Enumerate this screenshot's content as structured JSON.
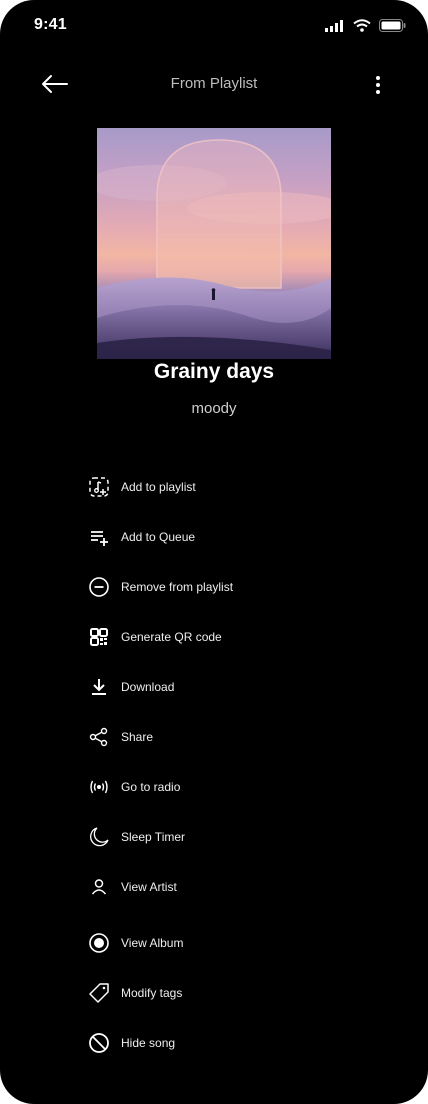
{
  "status_bar": {
    "time": "9:41"
  },
  "header": {
    "title": "From Playlist"
  },
  "track": {
    "title": "Grainy days",
    "subtitle": "moody"
  },
  "menu": [
    {
      "label": "Add to playlist",
      "icon": "add-to-playlist-icon"
    },
    {
      "label": "Add to Queue",
      "icon": "add-to-queue-icon"
    },
    {
      "label": "Remove from playlist",
      "icon": "remove-circle-icon"
    },
    {
      "label": "Generate QR code",
      "icon": "qr-code-icon"
    },
    {
      "label": "Download",
      "icon": "download-icon"
    },
    {
      "label": "Share",
      "icon": "share-icon"
    },
    {
      "label": "Go to radio",
      "icon": "radio-icon"
    },
    {
      "label": "Sleep Timer",
      "icon": "moon-icon"
    },
    {
      "label": "View Artist",
      "icon": "person-icon"
    },
    {
      "label": "View Album",
      "icon": "album-icon"
    },
    {
      "label": "Modify tags",
      "icon": "tag-icon"
    },
    {
      "label": "Hide song",
      "icon": "hide-icon"
    }
  ]
}
